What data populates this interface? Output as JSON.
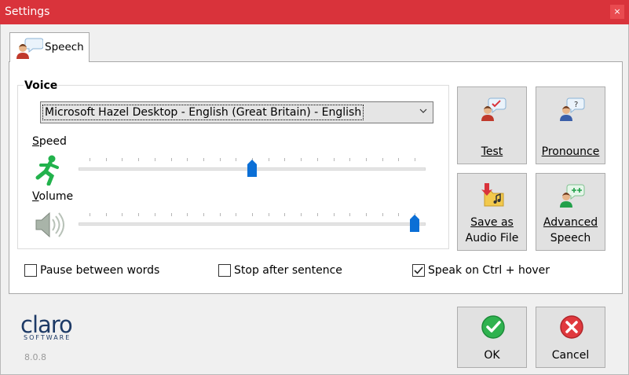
{
  "window": {
    "title": "Settings",
    "close_label": "×"
  },
  "tabs": [
    {
      "label": "Speech"
    }
  ],
  "voice": {
    "legend": "Voice",
    "selected_voice": "Microsoft Hazel Desktop - English (Great Britain) - English"
  },
  "speed": {
    "label": "Speed",
    "level_fraction": 0.5
  },
  "volume": {
    "label": "Volume",
    "level_fraction": 1.0
  },
  "buttons": {
    "test": "Test",
    "pronounce": "Pronounce",
    "save_audio_line1": "Save as",
    "save_audio_line2": "Audio File",
    "advanced_line1": "Advanced",
    "advanced_line2": "Speech",
    "ok": "OK",
    "cancel": "Cancel"
  },
  "checkboxes": {
    "pause": {
      "label": "Pause between words",
      "checked": false
    },
    "stop": {
      "label": "Stop after sentence",
      "checked": false
    },
    "speak": {
      "label": "Speak on Ctrl + hover",
      "checked": true
    }
  },
  "brand": {
    "logo_word": "claro",
    "logo_sub": "SOFTWARE",
    "version": "8.0.8"
  },
  "colors": {
    "titlebar": "#d9333b",
    "thumb": "#0b6fd6",
    "logo": "#1d3a66"
  }
}
